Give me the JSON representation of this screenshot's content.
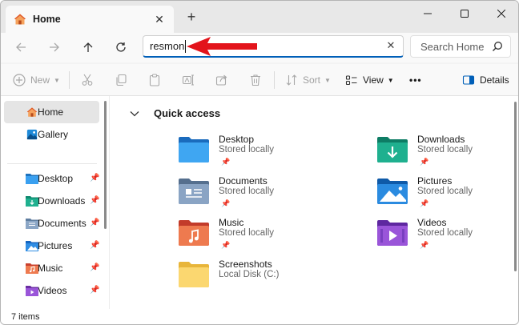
{
  "tab": {
    "title": "Home",
    "icon": "home-icon"
  },
  "address": {
    "value": "resmon"
  },
  "search": {
    "placeholder": "Search Home"
  },
  "commands": {
    "new_label": "New",
    "sort_label": "Sort",
    "view_label": "View",
    "more_label": "•••",
    "details_label": "Details"
  },
  "nav": {
    "items": [
      {
        "label": "Home",
        "icon": "home-icon",
        "selected": true
      },
      {
        "label": "Gallery",
        "icon": "gallery-icon"
      },
      {
        "label": "Desktop",
        "icon": "desktop-folder-icon",
        "pinned": true
      },
      {
        "label": "Downloads",
        "icon": "downloads-folder-icon",
        "pinned": true
      },
      {
        "label": "Documents",
        "icon": "documents-folder-icon",
        "pinned": true
      },
      {
        "label": "Pictures",
        "icon": "pictures-folder-icon",
        "pinned": true
      },
      {
        "label": "Music",
        "icon": "music-folder-icon",
        "pinned": true
      },
      {
        "label": "Videos",
        "icon": "videos-folder-icon",
        "pinned": true
      }
    ]
  },
  "quick_access": {
    "title": "Quick access",
    "items": [
      {
        "name": "Desktop",
        "sub": "Stored locally",
        "pinned": true,
        "icon": "desktop-folder-icon"
      },
      {
        "name": "Downloads",
        "sub": "Stored locally",
        "pinned": true,
        "icon": "downloads-folder-icon"
      },
      {
        "name": "Documents",
        "sub": "Stored locally",
        "pinned": true,
        "icon": "documents-folder-icon"
      },
      {
        "name": "Pictures",
        "sub": "Stored locally",
        "pinned": true,
        "icon": "pictures-folder-icon"
      },
      {
        "name": "Music",
        "sub": "Stored locally",
        "pinned": true,
        "icon": "music-folder-icon"
      },
      {
        "name": "Videos",
        "sub": "Stored locally",
        "pinned": true,
        "icon": "videos-folder-icon"
      },
      {
        "name": "Screenshots",
        "sub": "Local Disk (C:)",
        "pinned": false,
        "icon": "screenshots-folder-icon"
      }
    ]
  },
  "status": {
    "item_count": "7 items"
  },
  "colors": {
    "accent": "#005fb8",
    "annotation_arrow": "#e3141b"
  }
}
